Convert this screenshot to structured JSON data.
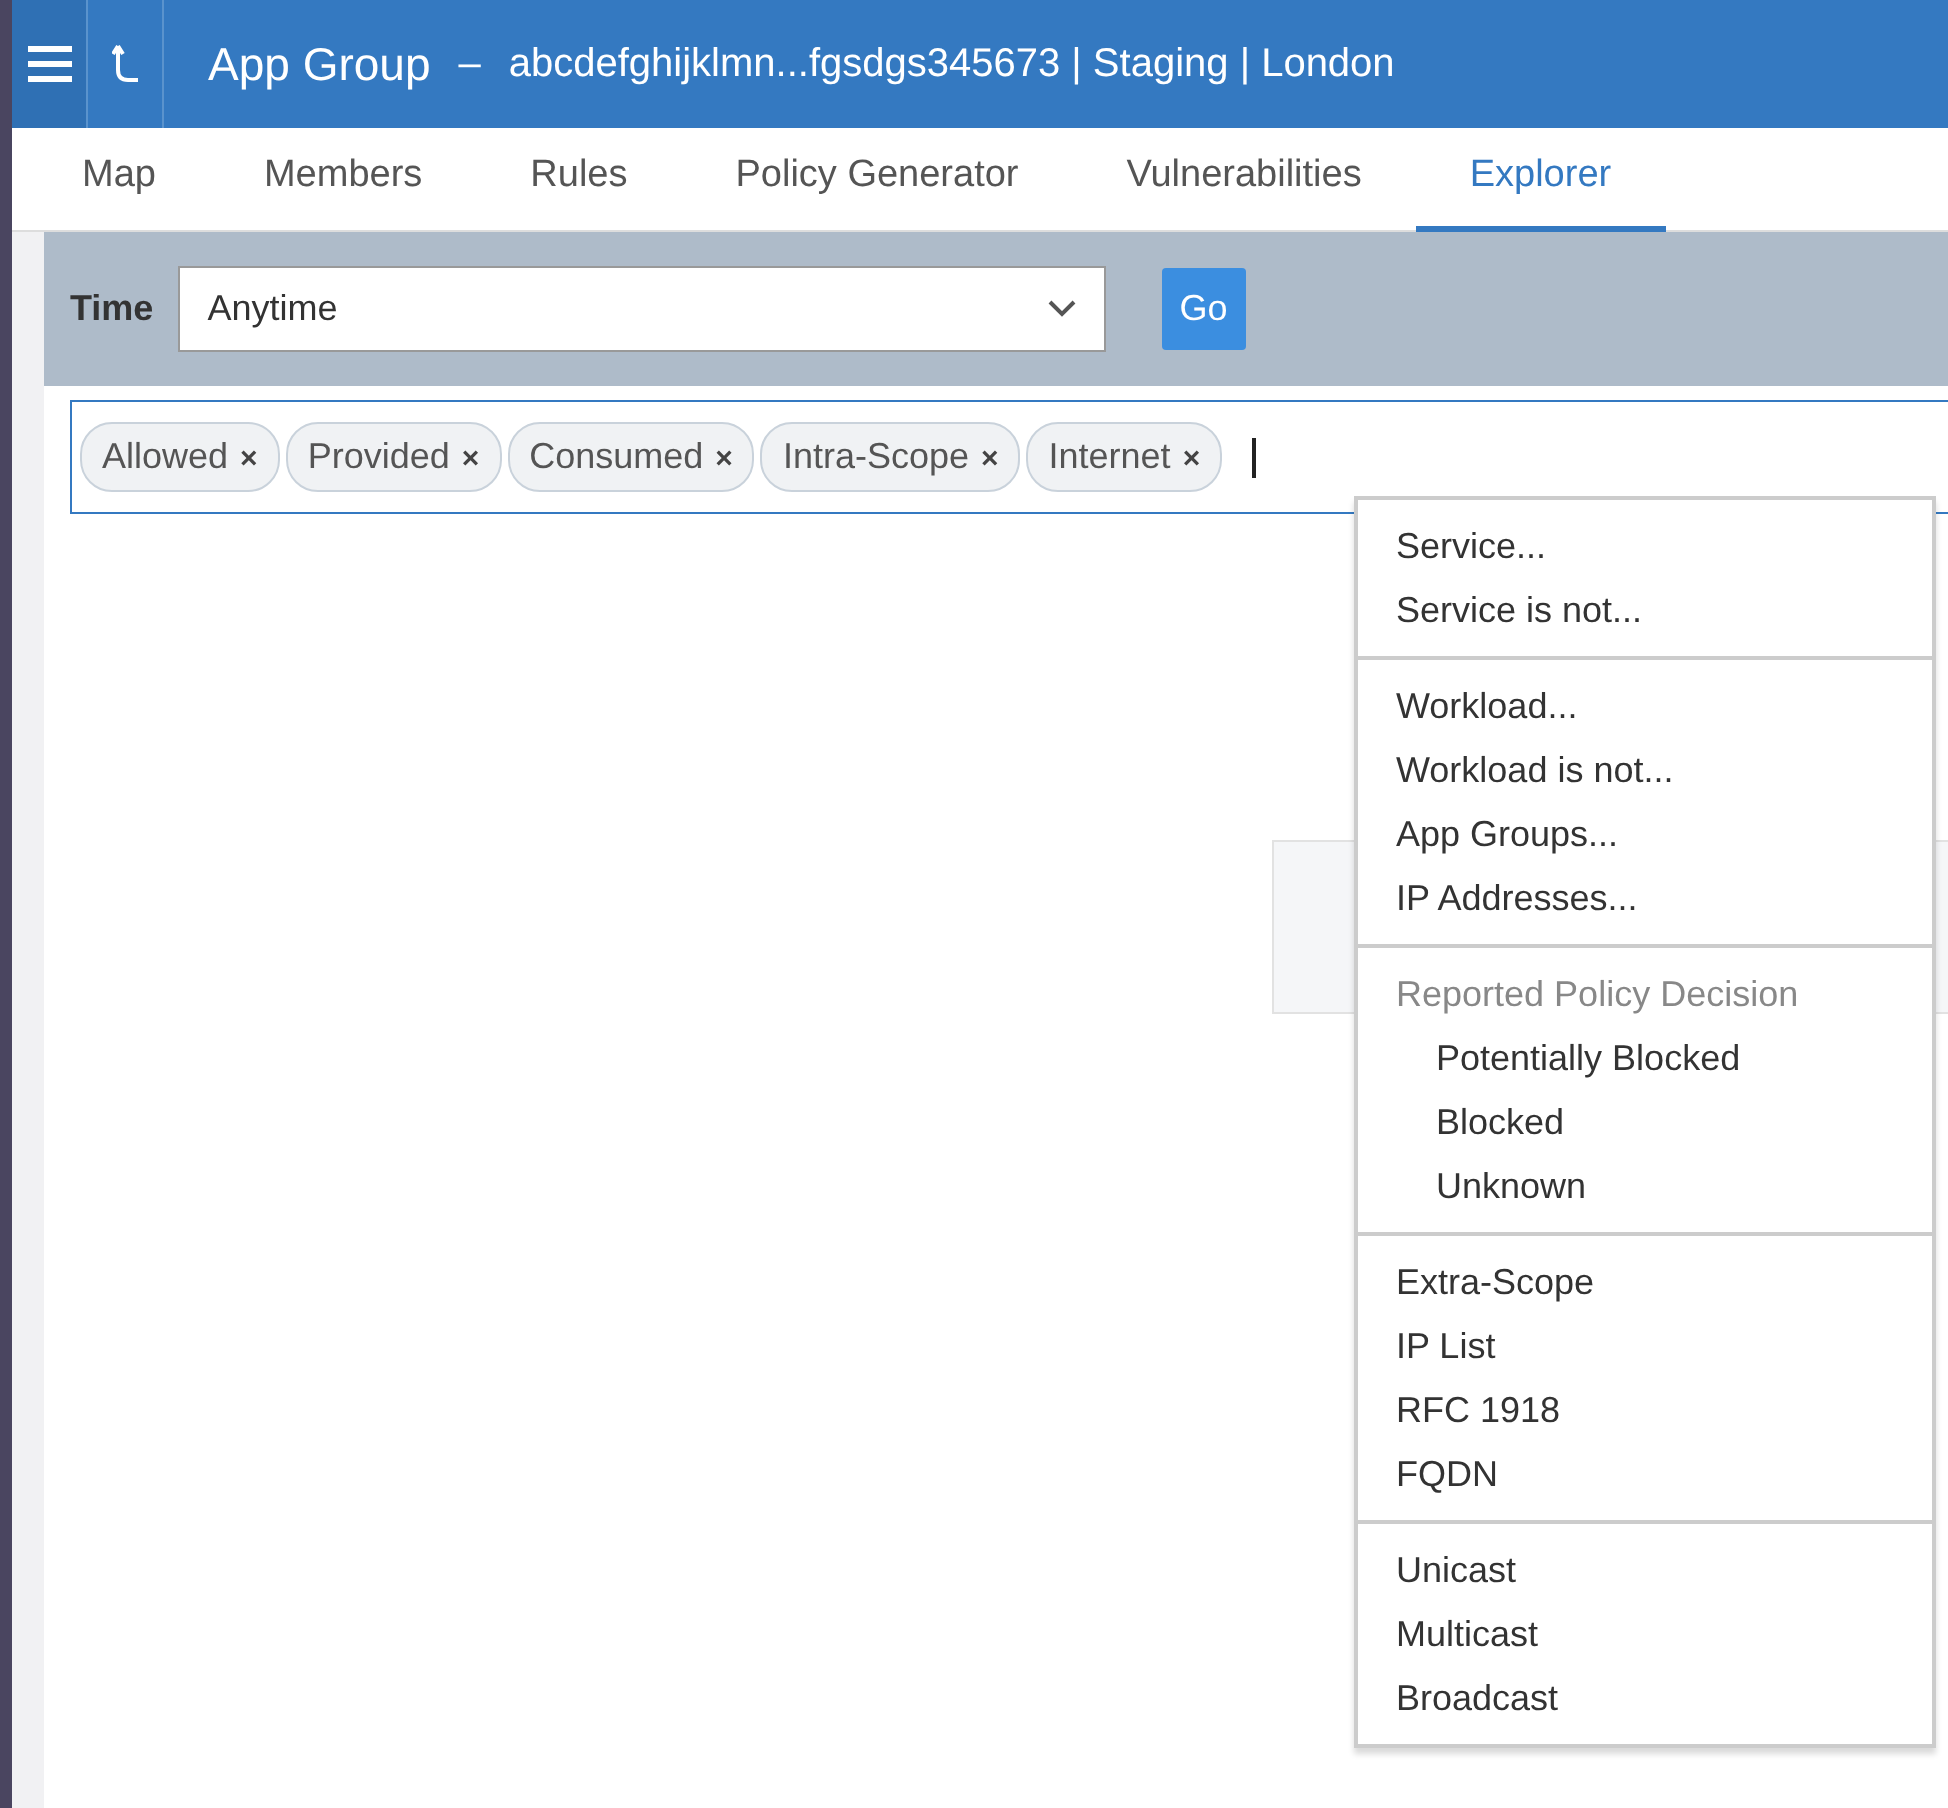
{
  "header": {
    "title": "App Group",
    "separator": "–",
    "subtitle": "abcdefghijklmn...fgsdgs345673 | Staging | London"
  },
  "tabs": [
    {
      "label": "Map",
      "selected": false
    },
    {
      "label": "Members",
      "selected": false
    },
    {
      "label": "Rules",
      "selected": false
    },
    {
      "label": "Policy Generator",
      "selected": false
    },
    {
      "label": "Vulnerabilities",
      "selected": false
    },
    {
      "label": "Explorer",
      "selected": true
    }
  ],
  "filter_bar": {
    "time_label": "Time",
    "time_value": "Anytime",
    "go_button": "Go"
  },
  "filter_tags": [
    {
      "label": "Allowed",
      "remove": "×"
    },
    {
      "label": "Provided",
      "remove": "×"
    },
    {
      "label": "Consumed",
      "remove": "×"
    },
    {
      "label": "Intra-Scope",
      "remove": "×"
    },
    {
      "label": "Internet",
      "remove": "×"
    }
  ],
  "dropdown": {
    "groups": [
      [
        {
          "kind": "item",
          "label": "Service..."
        },
        {
          "kind": "item",
          "label": "Service is not..."
        }
      ],
      [
        {
          "kind": "item",
          "label": "Workload..."
        },
        {
          "kind": "item",
          "label": "Workload is not..."
        },
        {
          "kind": "item",
          "label": "App Groups..."
        },
        {
          "kind": "item",
          "label": "IP Addresses..."
        }
      ],
      [
        {
          "kind": "header",
          "label": "Reported Policy Decision"
        },
        {
          "kind": "subitem",
          "label": "Potentially Blocked"
        },
        {
          "kind": "subitem",
          "label": "Blocked"
        },
        {
          "kind": "subitem",
          "label": "Unknown"
        }
      ],
      [
        {
          "kind": "item",
          "label": "Extra-Scope"
        },
        {
          "kind": "item",
          "label": "IP List"
        },
        {
          "kind": "item",
          "label": "RFC 1918"
        },
        {
          "kind": "item",
          "label": "FQDN"
        }
      ],
      [
        {
          "kind": "item",
          "label": "Unicast"
        },
        {
          "kind": "item",
          "label": "Multicast"
        },
        {
          "kind": "item",
          "label": "Broadcast"
        }
      ]
    ]
  }
}
